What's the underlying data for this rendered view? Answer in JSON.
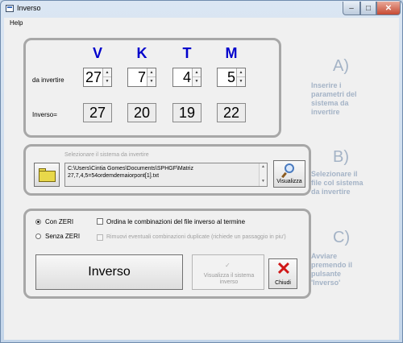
{
  "window": {
    "title": "Inverso",
    "min": "–",
    "max": "□",
    "close": "✕"
  },
  "menu": {
    "help": "Help"
  },
  "params": {
    "headers": [
      "V",
      "K",
      "T",
      "M"
    ],
    "row_label": "da invertire",
    "inputs": [
      "27",
      "7",
      "4",
      "5"
    ],
    "result_label": "Inverso=",
    "results": [
      "27",
      "20",
      "19",
      "22"
    ],
    "spin_up": "▲",
    "spin_down": "▼"
  },
  "file": {
    "caption": "Selezionare il sistema da invertire",
    "path_line1": "C:\\Users\\Cintia Gomes\\Documents\\SPHGF\\Matriz",
    "path_line2": "27,7,4,5=54ordemdemaiorpont[1].txt",
    "view_label": "Visualizza"
  },
  "options": {
    "radio_zeri": "Con ZERI",
    "radio_no_zeri": "Senza ZERI",
    "check_sort": "Ordina le combinazioni del file inverso al termine",
    "check_dup": "Rimuovi eventuali combinazioni duplicate (richiede un passaggio in piu')"
  },
  "actions": {
    "invert": "Inverso",
    "view_system_line1": "Visualizza il sistema",
    "view_system_line2": "inverso",
    "view_icon": "✓",
    "close": "Chiudi",
    "close_icon": "✕"
  },
  "steps": {
    "a_letter": "A)",
    "a_lines": [
      "Inserire i",
      "parametri del",
      "sistema da",
      "invertire"
    ],
    "b_letter": "B)",
    "b_lines": [
      "Selezionare il",
      "file col sistema",
      "da invertire"
    ],
    "c_letter": "C)",
    "c_lines": [
      "Avviare",
      "premendo il",
      "pulsante",
      "'Inverso'"
    ]
  },
  "colors": {
    "header_blue": "#0000cc",
    "step_text": "#a4b3c6",
    "close_red": "#d01818"
  }
}
